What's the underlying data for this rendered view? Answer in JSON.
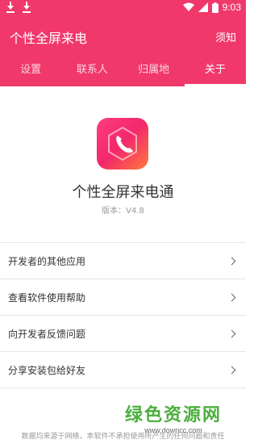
{
  "status_bar": {
    "time": "9:03"
  },
  "app_bar": {
    "title": "个性全屏来电",
    "notice": "须知"
  },
  "tabs": [
    {
      "label": "设置"
    },
    {
      "label": "联系人"
    },
    {
      "label": "归属地"
    },
    {
      "label": "关于"
    }
  ],
  "about": {
    "app_name": "个性全屏来电通",
    "version": "版本：V4.8"
  },
  "menu": [
    {
      "label": "开发者的其他应用"
    },
    {
      "label": "查看软件使用帮助"
    },
    {
      "label": "向开发者反馈问题"
    },
    {
      "label": "分享安装包给好友"
    }
  ],
  "watermark": {
    "title": "绿色资源网",
    "url": "www.downcc.com"
  },
  "footer": {
    "text": "数据均来源于网络，本软件不承担使用所产生的任何问题和责任"
  },
  "colors": {
    "accent": "#f0386b",
    "watermark": "#4caf3f"
  }
}
